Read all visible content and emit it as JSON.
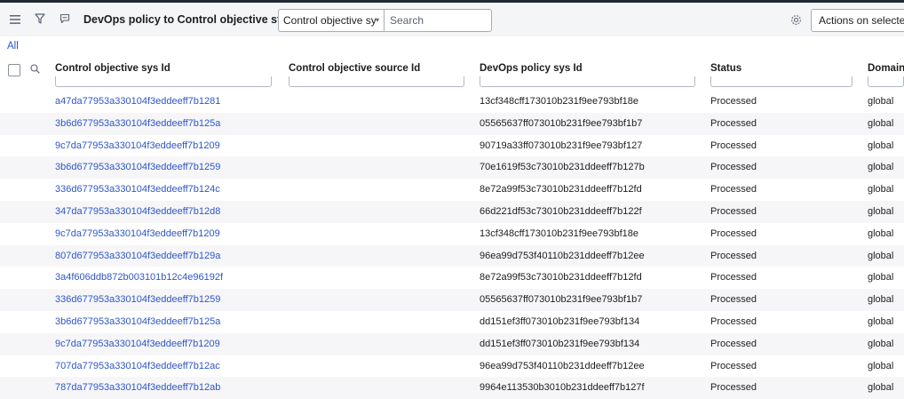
{
  "header": {
    "title": "DevOps policy to Control objective staging",
    "field_select": "Control objective sy",
    "search_placeholder": "Search",
    "actions_label": "Actions on selected"
  },
  "breadcrumb": "All",
  "columns": [
    {
      "label": "Control objective sys Id"
    },
    {
      "label": "Control objective source Id"
    },
    {
      "label": "DevOps policy sys Id"
    },
    {
      "label": "Status"
    },
    {
      "label": "Domain"
    }
  ],
  "rows": [
    {
      "control_objective_sys_id": "a47da77953a330104f3eddeeff7b1281",
      "source_id": "",
      "devops_policy_sys_id": "13cf348cff173010b231f9ee793bf18e",
      "status": "Processed",
      "domain": "global"
    },
    {
      "control_objective_sys_id": "3b6d677953a330104f3eddeeff7b125a",
      "source_id": "",
      "devops_policy_sys_id": "05565637ff073010b231f9ee793bf1b7",
      "status": "Processed",
      "domain": "global"
    },
    {
      "control_objective_sys_id": "9c7da77953a330104f3eddeeff7b1209",
      "source_id": "",
      "devops_policy_sys_id": "90719a33ff073010b231f9ee793bf127",
      "status": "Processed",
      "domain": "global"
    },
    {
      "control_objective_sys_id": "3b6d677953a330104f3eddeeff7b1259",
      "source_id": "",
      "devops_policy_sys_id": "70e1619f53c73010b231ddeeff7b127b",
      "status": "Processed",
      "domain": "global"
    },
    {
      "control_objective_sys_id": "336d677953a330104f3eddeeff7b124c",
      "source_id": "",
      "devops_policy_sys_id": "8e72a99f53c73010b231ddeeff7b12fd",
      "status": "Processed",
      "domain": "global"
    },
    {
      "control_objective_sys_id": "347da77953a330104f3eddeeff7b12d8",
      "source_id": "",
      "devops_policy_sys_id": "66d221df53c73010b231ddeeff7b122f",
      "status": "Processed",
      "domain": "global"
    },
    {
      "control_objective_sys_id": "9c7da77953a330104f3eddeeff7b1209",
      "source_id": "",
      "devops_policy_sys_id": "13cf348cff173010b231f9ee793bf18e",
      "status": "Processed",
      "domain": "global"
    },
    {
      "control_objective_sys_id": "807d677953a330104f3eddeeff7b129a",
      "source_id": "",
      "devops_policy_sys_id": "96ea99d753f40110b231ddeeff7b12ee",
      "status": "Processed",
      "domain": "global"
    },
    {
      "control_objective_sys_id": "3a4f606ddb872b003101b12c4e96192f",
      "source_id": "",
      "devops_policy_sys_id": "8e72a99f53c73010b231ddeeff7b12fd",
      "status": "Processed",
      "domain": "global"
    },
    {
      "control_objective_sys_id": "336d677953a330104f3eddeeff7b1259",
      "source_id": "",
      "devops_policy_sys_id": "05565637ff073010b231f9ee793bf1b7",
      "status": "Processed",
      "domain": "global"
    },
    {
      "control_objective_sys_id": "3b6d677953a330104f3eddeeff7b125a",
      "source_id": "",
      "devops_policy_sys_id": "dd151ef3ff073010b231f9ee793bf134",
      "status": "Processed",
      "domain": "global"
    },
    {
      "control_objective_sys_id": "9c7da77953a330104f3eddeeff7b1209",
      "source_id": "",
      "devops_policy_sys_id": "dd151ef3ff073010b231f9ee793bf134",
      "status": "Processed",
      "domain": "global"
    },
    {
      "control_objective_sys_id": "707da77953a330104f3eddeeff7b12ac",
      "source_id": "",
      "devops_policy_sys_id": "96ea99d753f40110b231ddeeff7b12ee",
      "status": "Processed",
      "domain": "global"
    },
    {
      "control_objective_sys_id": "787da77953a330104f3eddeeff7b12ab",
      "source_id": "",
      "devops_policy_sys_id": "9964e113530b3010b231ddeeff7b127f",
      "status": "Processed",
      "domain": "global"
    }
  ],
  "colors": {
    "link": "#2f56c7",
    "header_bg": "#f4f5f7",
    "stripe": "#f6f6f8"
  }
}
